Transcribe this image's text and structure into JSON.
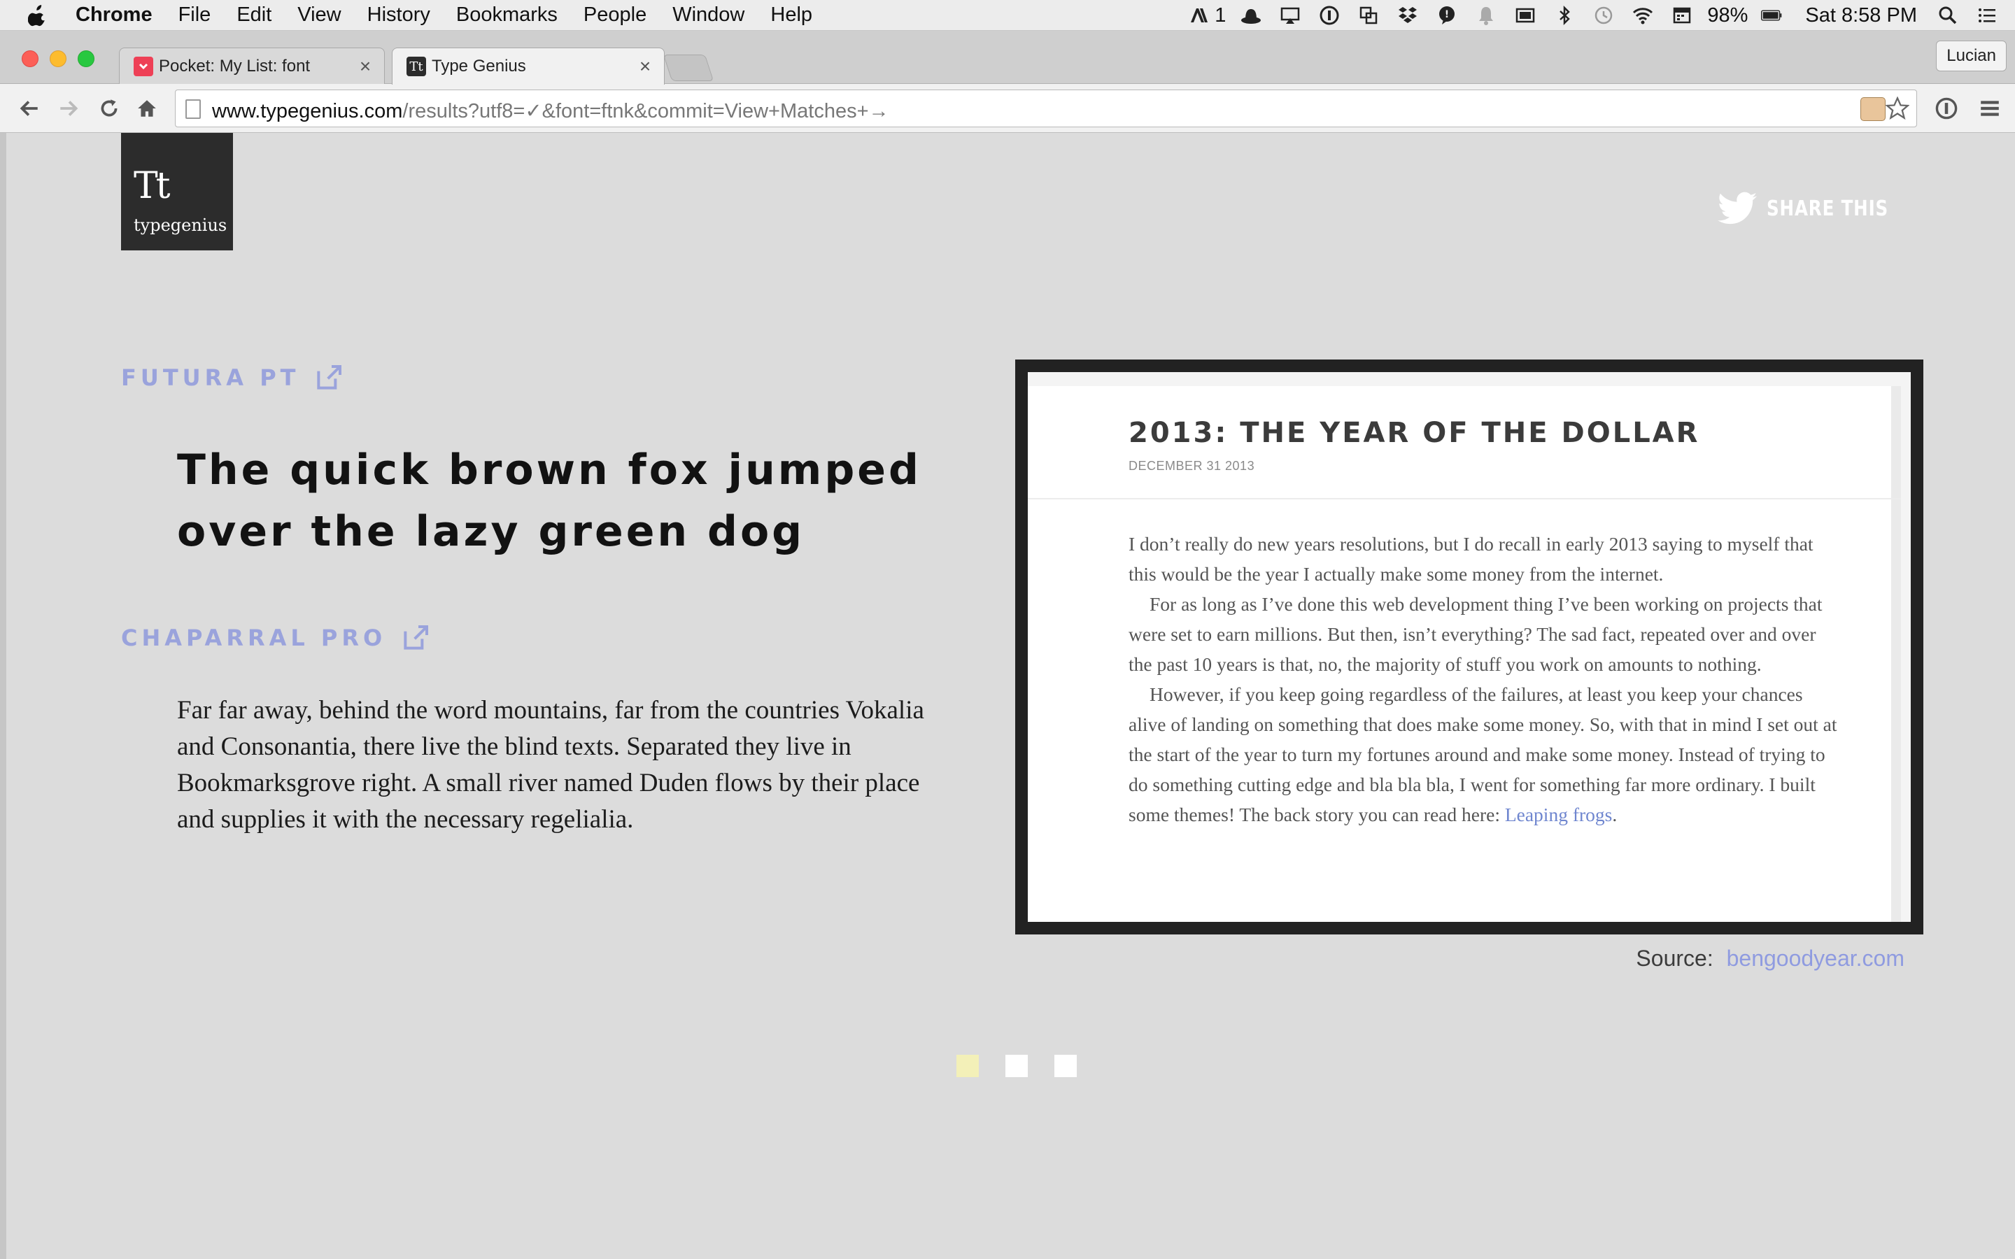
{
  "menubar": {
    "apple_icon": "apple-icon",
    "app_name": "Chrome",
    "items": [
      "File",
      "Edit",
      "View",
      "History",
      "Bookmarks",
      "People",
      "Window",
      "Help"
    ],
    "adobe_badge": "1",
    "battery_percent": "98%",
    "clock": "Sat 8:58 PM"
  },
  "tabs": [
    {
      "title": "Pocket: My List: font",
      "icon": "pocket-icon",
      "color": "#ee4056"
    },
    {
      "title": "Type Genius",
      "icon": "typegenius-icon",
      "color": "#2c2c2c"
    }
  ],
  "profile": {
    "name": "Lucian"
  },
  "address_bar": {
    "domain": "www.typegenius.com",
    "path": "/results?utf8=✓&font=ftnk&commit=View+Matches+→"
  },
  "site": {
    "logo": {
      "mark": "Tt",
      "name": "typegenius"
    },
    "share_label": "SHARE THIS"
  },
  "fonts": [
    {
      "name": "FUTURA PT",
      "sample": "The quick brown fox jumped over the lazy green dog"
    },
    {
      "name": "CHAPARRAL PRO",
      "sample": "Far far away, behind the word mountains, far from the countries Vokalia and Consonantia, there live the blind texts. Separated they live in Bookmarksgrove right. A small river named Duden flows by their place and supplies it with the necessary regelialia."
    }
  ],
  "preview": {
    "title": "2013: THE YEAR OF THE DOLLAR",
    "date": "DECEMBER 31 2013",
    "paragraphs": [
      "I don’t really do new years resolutions, but I do recall in early 2013 saying to myself that this would be the year I actually make some money from the internet.",
      "For as long as I’ve done this web development thing I’ve been working on projects that were set to earn millions. But then, isn’t everything? The sad fact, repeated over and over the past 10 years is that, no, the majority of stuff you work on amounts to nothing.",
      "However, if you keep going regardless of the failures, at least you keep your chances alive of landing on something that does make some money. So, with that in mind I set out at the start of the year to turn my fortunes around and make some money. Instead of trying to do something cutting edge and bla bla bla, I went for something far more ordinary. I built some themes! The back story you can read here: "
    ],
    "link_text": "Leaping frogs",
    "link_suffix": "."
  },
  "source": {
    "label": "Source:",
    "link": "bengoodyear.com"
  },
  "pagination": {
    "count": 3,
    "active_index": 0
  },
  "colors": {
    "accent": "#9aa3dc",
    "link": "#6f86cf",
    "active_dot": "#f3f0b8"
  }
}
